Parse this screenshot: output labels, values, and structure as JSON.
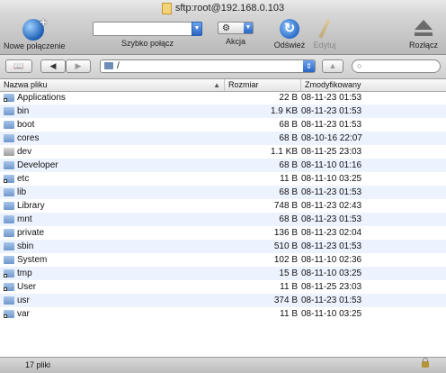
{
  "window": {
    "title": "sftp:root@192.168.0.103"
  },
  "toolbar": {
    "new_connection": "Nowe połączenie",
    "quick_connect": "Szybko połącz",
    "action": "Akcja",
    "refresh": "Odśwież",
    "edit": "Edytuj",
    "disconnect": "Rozłącz"
  },
  "pathbar": {
    "path": "/"
  },
  "columns": {
    "name": "Nazwa pliku",
    "size": "Rozmiar",
    "modified": "Zmodyfikowany"
  },
  "files": [
    {
      "name": "Applications",
      "size": "22 B",
      "modified": "08-11-23 01:53",
      "icon": "folder-link-icon"
    },
    {
      "name": "bin",
      "size": "1.9 KB",
      "modified": "08-11-23 01:53",
      "icon": "folder-icon"
    },
    {
      "name": "boot",
      "size": "68 B",
      "modified": "08-11-23 01:53",
      "icon": "folder-icon"
    },
    {
      "name": "cores",
      "size": "68 B",
      "modified": "08-10-16 22:07",
      "icon": "folder-icon"
    },
    {
      "name": "dev",
      "size": "1.1 KB",
      "modified": "08-11-25 23:03",
      "icon": "device-folder-icon"
    },
    {
      "name": "Developer",
      "size": "68 B",
      "modified": "08-11-10 01:16",
      "icon": "folder-icon"
    },
    {
      "name": "etc",
      "size": "11 B",
      "modified": "08-11-10 03:25",
      "icon": "folder-link-icon"
    },
    {
      "name": "lib",
      "size": "68 B",
      "modified": "08-11-23 01:53",
      "icon": "folder-icon"
    },
    {
      "name": "Library",
      "size": "748 B",
      "modified": "08-11-23 02:43",
      "icon": "folder-icon"
    },
    {
      "name": "mnt",
      "size": "68 B",
      "modified": "08-11-23 01:53",
      "icon": "folder-icon"
    },
    {
      "name": "private",
      "size": "136 B",
      "modified": "08-11-23 02:04",
      "icon": "folder-icon"
    },
    {
      "name": "sbin",
      "size": "510 B",
      "modified": "08-11-23 01:53",
      "icon": "folder-icon"
    },
    {
      "name": "System",
      "size": "102 B",
      "modified": "08-11-10 02:36",
      "icon": "folder-icon"
    },
    {
      "name": "tmp",
      "size": "15 B",
      "modified": "08-11-10 03:25",
      "icon": "folder-link-icon"
    },
    {
      "name": "User",
      "size": "11 B",
      "modified": "08-11-25 23:03",
      "icon": "folder-link-icon"
    },
    {
      "name": "usr",
      "size": "374 B",
      "modified": "08-11-23 01:53",
      "icon": "folder-icon"
    },
    {
      "name": "var",
      "size": "11 B",
      "modified": "08-11-10 03:25",
      "icon": "folder-link-icon"
    }
  ],
  "status": {
    "count": "17 pliki"
  }
}
